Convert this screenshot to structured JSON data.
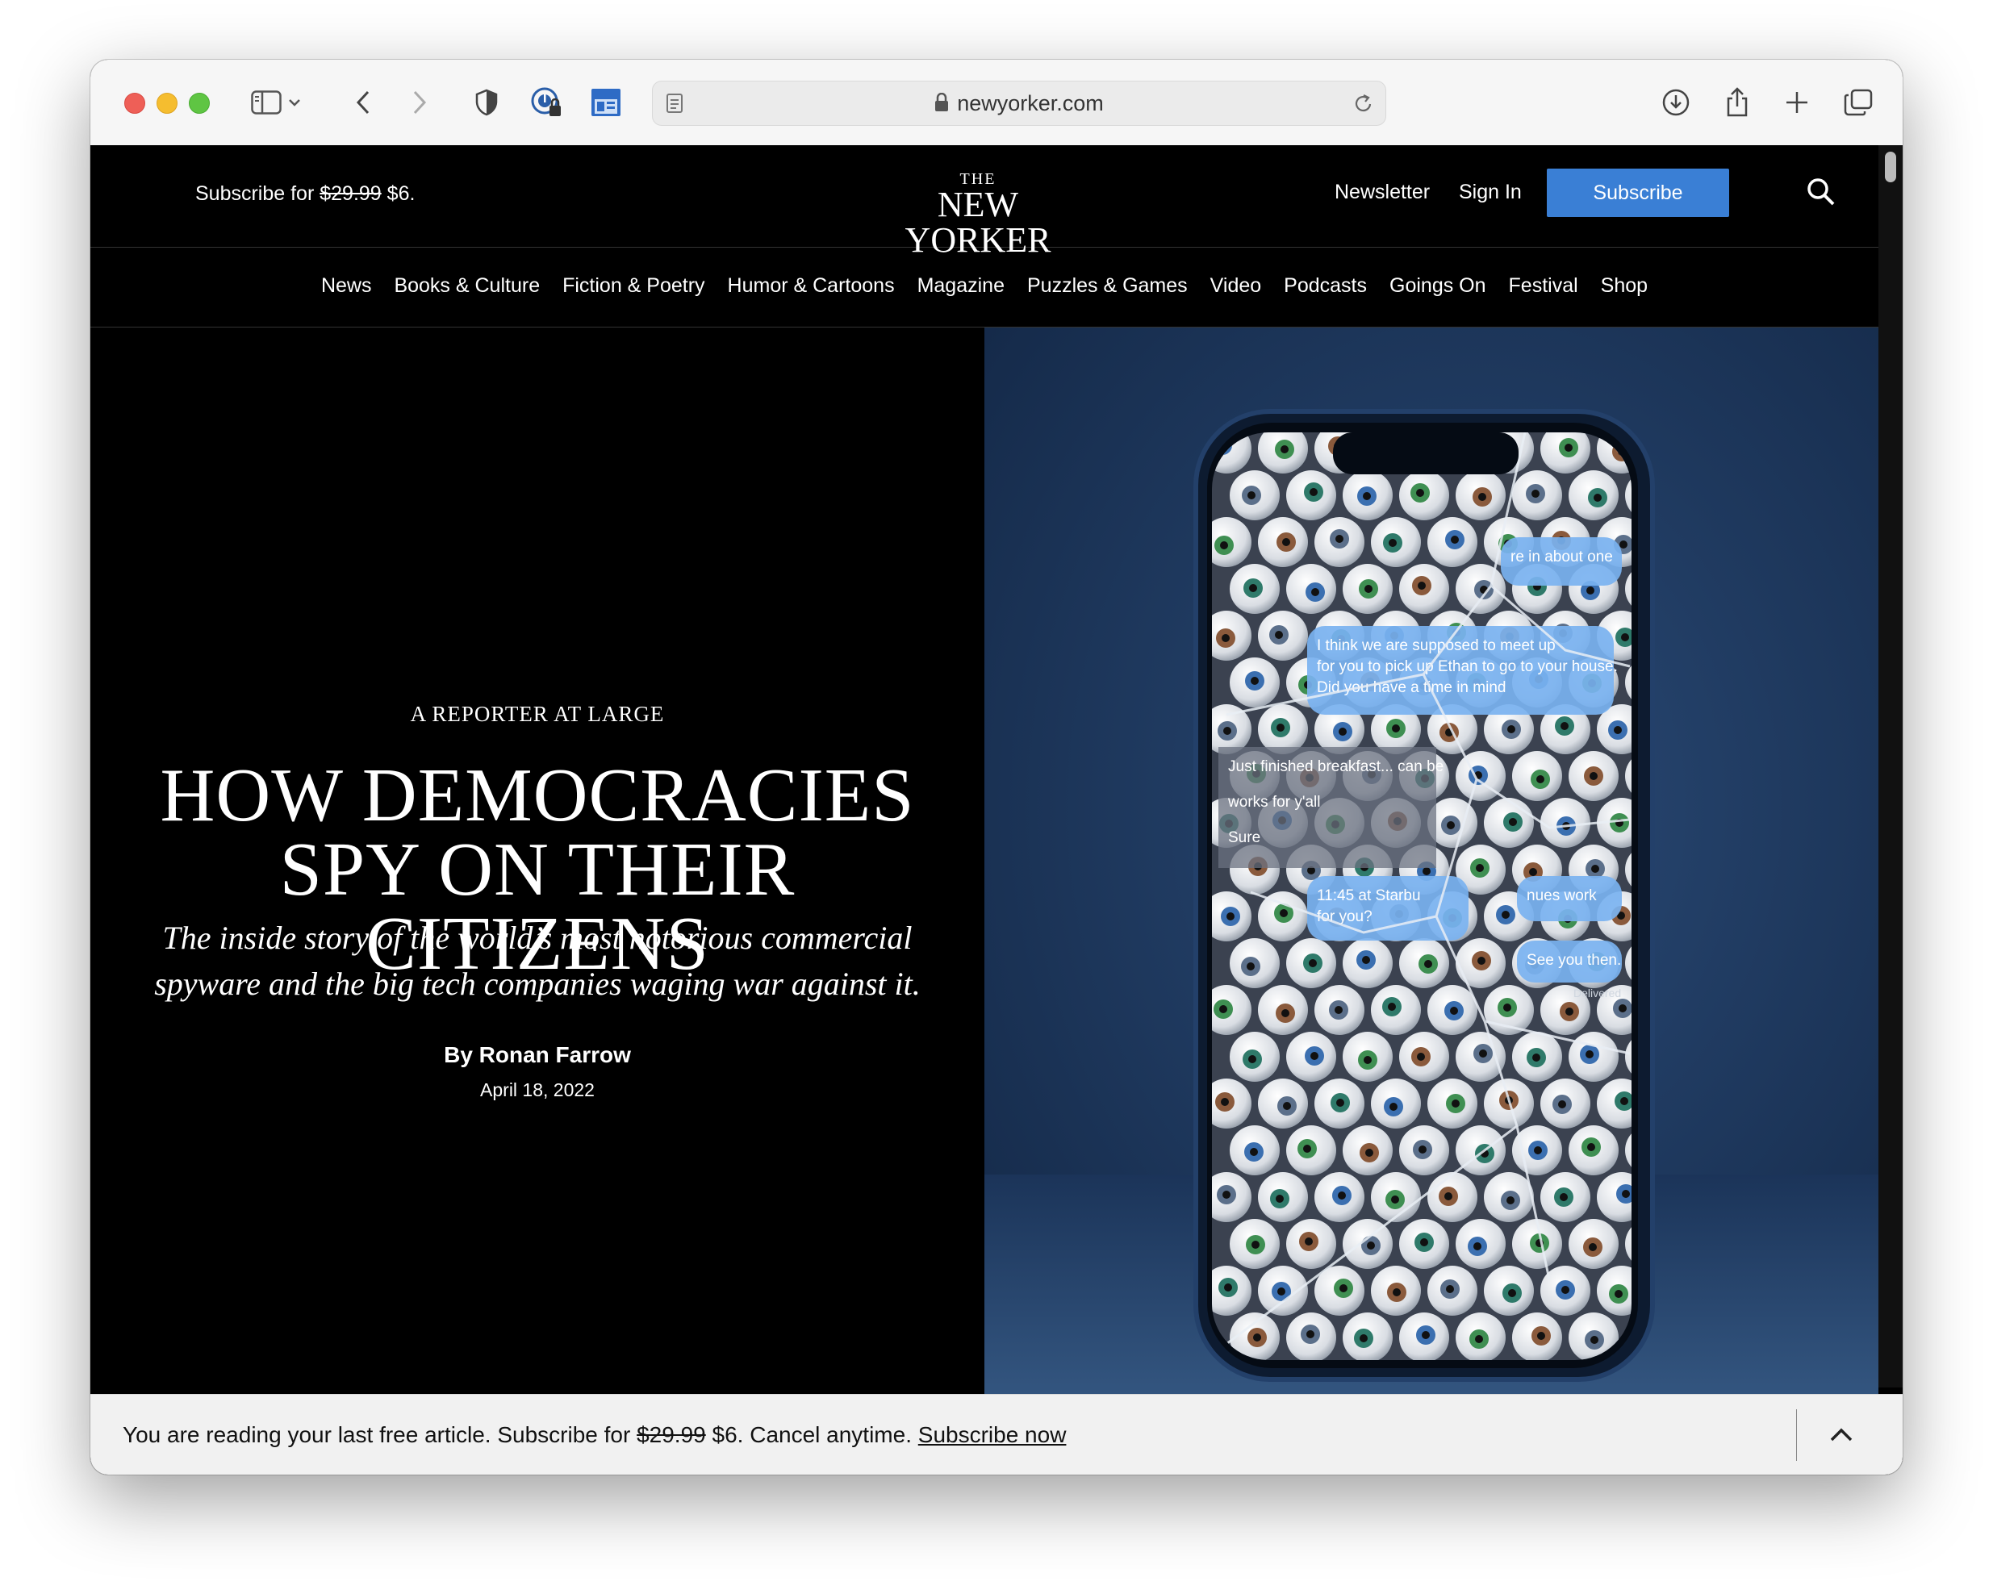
{
  "browser": {
    "url": "newyorker.com",
    "icons": [
      "sidebar-icon",
      "chevron-down-icon",
      "back-icon",
      "forward-icon",
      "shield-icon",
      "password-icon",
      "reader-extension-icon",
      "page-icon",
      "lock-icon",
      "reload-icon",
      "download-icon",
      "share-icon",
      "new-tab-icon",
      "tabs-overview-icon"
    ]
  },
  "header": {
    "promo_prefix": "Subscribe for",
    "promo_old_price": "$29.99",
    "promo_new_price": "$6.",
    "logo_the": "THE",
    "logo_name": "NEW YORKER",
    "newsletter": "Newsletter",
    "sign_in": "Sign In",
    "subscribe": "Subscribe"
  },
  "nav": {
    "items": [
      "News",
      "Books & Culture",
      "Fiction & Poetry",
      "Humor & Cartoons",
      "Magazine",
      "Puzzles & Games",
      "Video",
      "Podcasts",
      "Goings On",
      "Festival",
      "Shop"
    ]
  },
  "article": {
    "rubric": "A REPORTER AT LARGE",
    "headline_line1": "HOW DEMOCRACIES",
    "headline_line2": "SPY ON THEIR CITIZENS",
    "dek_line1": "The inside story of the world’s most notorious commercial",
    "dek_line2": "spyware and the big tech companies waging war against it.",
    "byline_prefix": "By",
    "author": "Ronan Farrow",
    "date": "April 18, 2022"
  },
  "hero_image": {
    "messages": [
      "re in about one",
      "I think we are supposed to meet up",
      "for you to pick up Ethan to go to your house.",
      "Did you have a time in mind",
      "Just finished breakfast... can be",
      "works for y'all",
      "Sure",
      "11:45 at Starbu",
      "for you?",
      "nues work",
      "See you then.",
      "Delivered"
    ],
    "bubble_color": "#7ab2f0",
    "background_color": "#1d3558"
  },
  "banner": {
    "text_before": "You are reading your last free article. Subscribe for",
    "old_price": "$29.99",
    "text_after": "$6. Cancel anytime.",
    "link": "Subscribe now"
  }
}
